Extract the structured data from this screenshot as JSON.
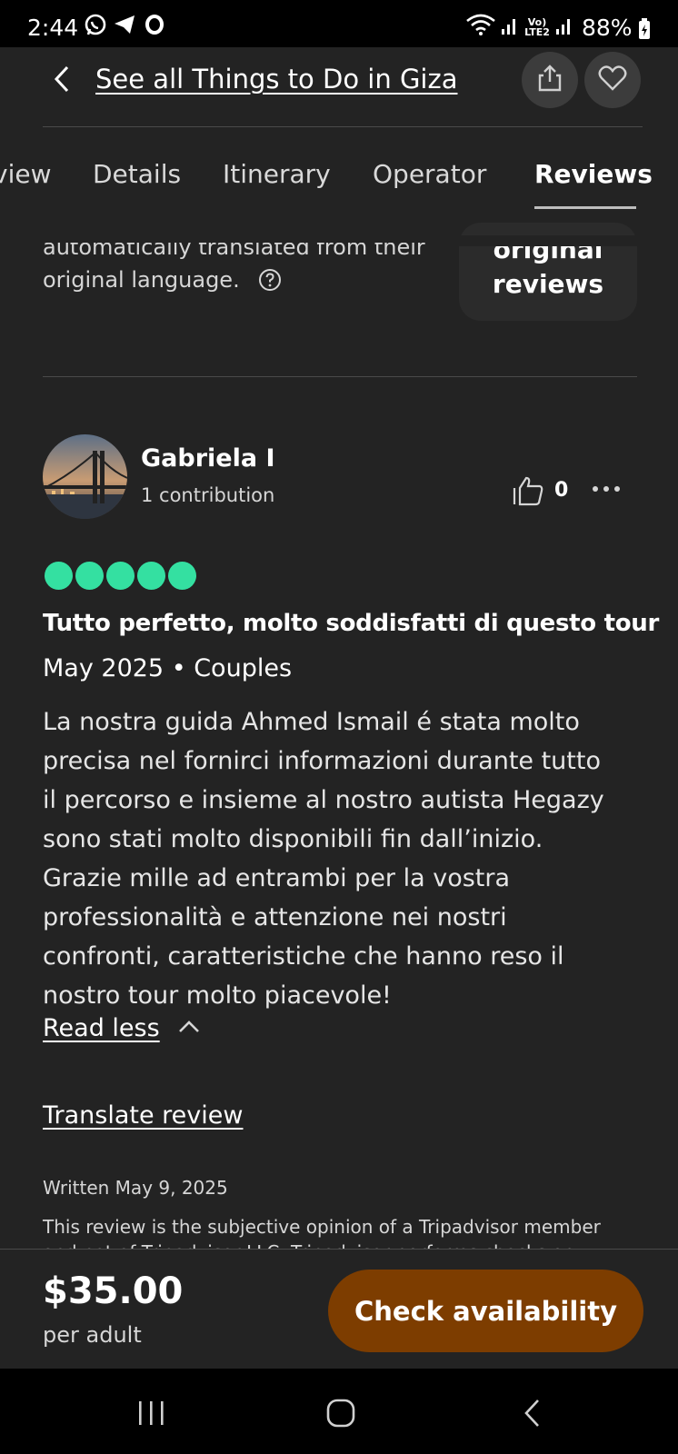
{
  "status_bar": {
    "time": "2:44",
    "battery": "88%",
    "network_badge": "Vo) LTE2"
  },
  "header": {
    "back_link": "See all Things to Do in Giza",
    "tabs": [
      {
        "label": "view"
      },
      {
        "label": "Details"
      },
      {
        "label": "Itinerary"
      },
      {
        "label": "Operator"
      },
      {
        "label": "Reviews",
        "active": true
      }
    ]
  },
  "translation_notice": {
    "line1": "automatically translated from their",
    "line2": "original language.",
    "original_button_line1": "original",
    "original_button_line2": "reviews"
  },
  "review": {
    "author": "Gabriela I",
    "contributions": "1 contribution",
    "helpful_count": "0",
    "rating": 5,
    "rating_color": "#34e0a1",
    "title": "Tutto perfetto, molto soddisfatti di questo tour",
    "date_type": "May 2025 • Couples",
    "body_lines": [
      "La nostra guida Ahmed Ismail é stata molto",
      "precisa nel fornirci informazioni durante tutto",
      "il percorso e insieme al nostro autista Hegazy",
      "sono stati molto disponibili fin dall’inizio.",
      "Grazie mille ad entrambi per la vostra",
      "professionalità e attenzione nei nostri",
      "confronti, caratteristiche che hanno reso il",
      "nostro tour molto piacevole!"
    ],
    "read_less": "Read less",
    "translate": "Translate review",
    "written": "Written May 9, 2025",
    "disclaimer_line1": "This review is the subjective opinion of a Tripadvisor member",
    "disclaimer_line2": "and not of Tripadvisor LLC. Tripadvisor performs checks on"
  },
  "booking": {
    "price": "$35.00",
    "price_unit": "per adult",
    "cta": "Check availability",
    "cta_color": "#7d3d00"
  }
}
